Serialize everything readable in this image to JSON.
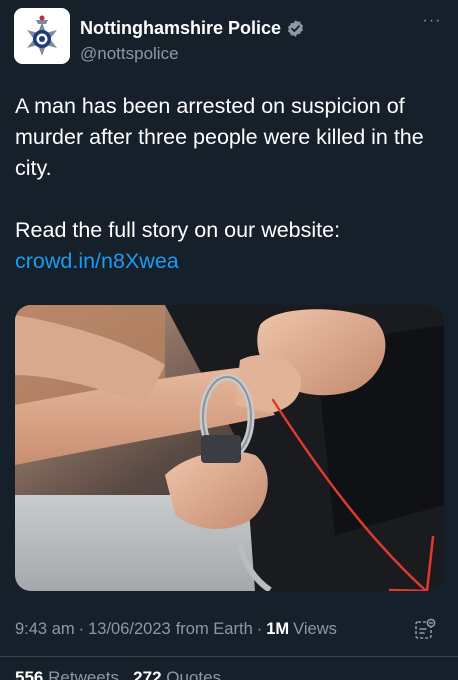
{
  "author": {
    "display_name": "Nottinghamshire Police",
    "handle": "@nottspolice",
    "verified": true,
    "avatar_icon": "police-badge-icon"
  },
  "menu": {
    "more_label": "···"
  },
  "tweet": {
    "line1": "A man has been arrested on suspicion of murder after three people were killed in the city.",
    "line2_text": "Read the full story on our website: ",
    "line2_link": "crowd.in/n8Xwea"
  },
  "media": {
    "alt": "Photo of a person's wrist being handcuffed",
    "annotation_color": "#e03a2f"
  },
  "meta": {
    "time": "9:43 am",
    "date": "13/06/2023",
    "source": "from Earth",
    "views_count": "1M",
    "views_label": "Views"
  },
  "stats": {
    "retweets_count": "556",
    "retweets_label": "Retweets",
    "quotes_count": "272",
    "quotes_label": "Quotes"
  },
  "colors": {
    "background": "#15202b",
    "text": "#ffffff",
    "secondary": "#8b98a5",
    "link": "#1d9bf0",
    "divider": "#38444d"
  }
}
